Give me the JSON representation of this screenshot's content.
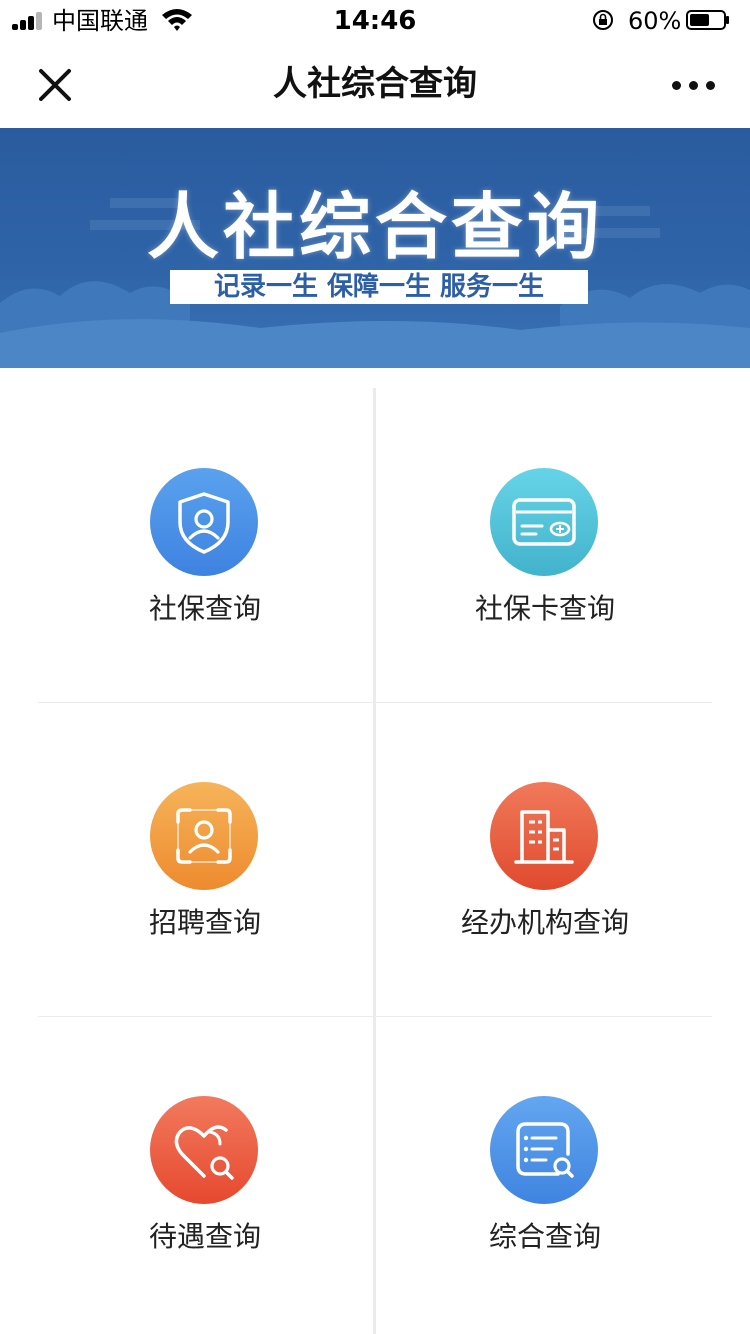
{
  "status_bar": {
    "carrier": "中国联通",
    "time": "14:46",
    "battery_percent": "60%",
    "battery_level": 0.6
  },
  "nav": {
    "title": "人社综合查询",
    "close_icon": "close-icon",
    "more_icon": "more-icon"
  },
  "banner": {
    "title": "人社综合查询",
    "slogan": "记录一生 保障一生 服务一生",
    "background_color": "#2d5fa6"
  },
  "tiles": [
    {
      "label": "社保查询",
      "icon": "shield-user-icon",
      "color": "#4a8fe6"
    },
    {
      "label": "社保卡查询",
      "icon": "social-security-card-icon",
      "color": "#4fc3d9"
    },
    {
      "label": "招聘查询",
      "icon": "person-scan-icon",
      "color": "#f19a3e"
    },
    {
      "label": "经办机构查询",
      "icon": "building-icon",
      "color": "#ea5b3e"
    },
    {
      "label": "待遇查询",
      "icon": "heart-search-icon",
      "color": "#ec6148"
    },
    {
      "label": "综合查询",
      "icon": "document-search-icon",
      "color": "#4d90e4"
    }
  ]
}
